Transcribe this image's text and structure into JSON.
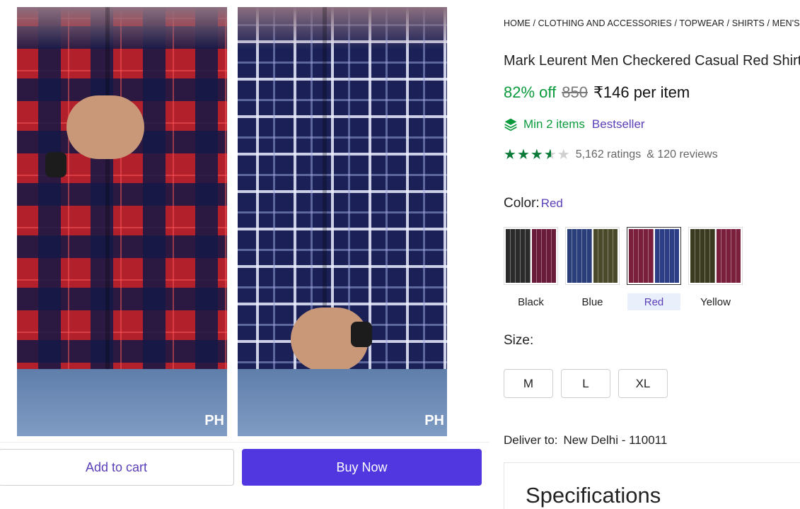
{
  "breadcrumb": "HOME / CLOTHING AND ACCESSORIES / TOPWEAR / SHIRTS / MEN'S SHIRTS",
  "product": {
    "title": "Mark Leurent Men Checkered Casual Red Shirt",
    "discount": "82% off",
    "mrp": "850",
    "price": "₹146 per item",
    "min_items": "Min 2 items",
    "badge": "Bestseller",
    "rating_value": 3.5,
    "ratings": "5,162 ratings",
    "reviews": "& 120 reviews"
  },
  "gallery": {
    "watermark": "PH"
  },
  "color": {
    "label": "Color:",
    "selected": "Red",
    "options": [
      {
        "label": "Black",
        "colors": [
          "#2b2b2b",
          "#6a1b3a"
        ]
      },
      {
        "label": "Blue",
        "colors": [
          "#2a3f7a",
          "#4a4a2a"
        ]
      },
      {
        "label": "Red",
        "colors": [
          "#7a1f3c",
          "#2c3e86"
        ]
      },
      {
        "label": "Yellow",
        "colors": [
          "#3a3a20",
          "#7a1f3c"
        ]
      }
    ]
  },
  "size": {
    "label": "Size:",
    "options": [
      "M",
      "L",
      "XL"
    ]
  },
  "delivery": {
    "label": "Deliver to:",
    "location": "New Delhi - 110011"
  },
  "specifications_title": "Specifications",
  "actions": {
    "add_to_cart": "Add to cart",
    "buy_now": "Buy Now"
  }
}
